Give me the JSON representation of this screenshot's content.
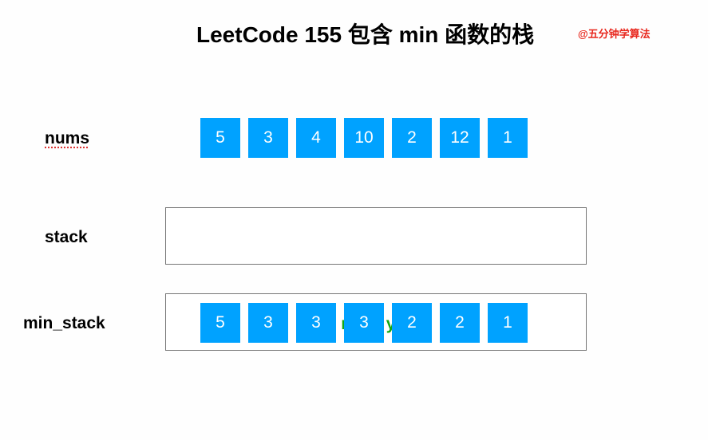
{
  "title": "LeetCode 155 包含 min 函数的栈",
  "credit": "@五分钟学算法",
  "labels": {
    "nums": "nums",
    "stack": "stack",
    "min_stack": "min_stack"
  },
  "nums": [
    "5",
    "3",
    "4",
    "10",
    "2",
    "12",
    "1"
  ],
  "stack": [],
  "stack_empty_text": "empty",
  "min_stack": [
    "5",
    "3",
    "3",
    "3",
    "2",
    "2",
    "1"
  ],
  "colors": {
    "box": "#00a2ff",
    "credit": "#e8261c",
    "empty_text": "#13a813"
  }
}
